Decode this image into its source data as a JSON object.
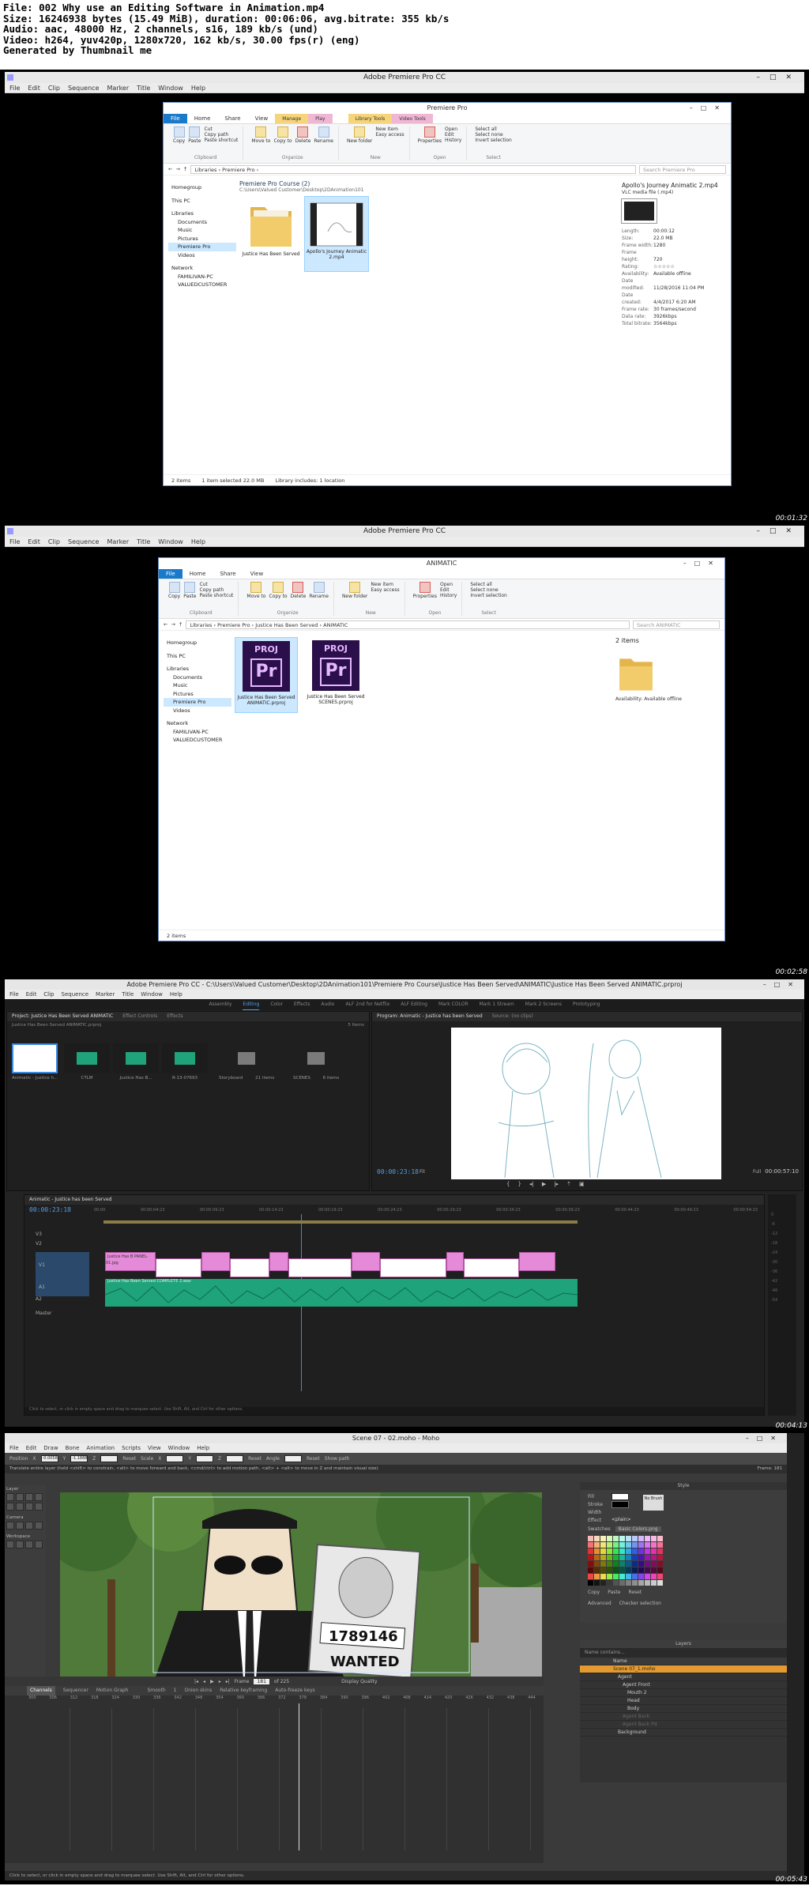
{
  "header": {
    "lines": [
      "File: 002 Why use an Editing Software in Animation.mp4",
      "Size: 16246938 bytes (15.49 MiB), duration: 00:06:06, avg.bitrate: 355 kb/s",
      "Audio: aac, 48000 Hz, 2 channels, s16, 189 kb/s (und)",
      "Video: h264, yuv420p, 1280x720, 162 kb/s, 30.00 fps(r) (eng)",
      "Generated by Thumbnail me"
    ]
  },
  "frame1": {
    "timestamp": "00:01:32",
    "host_title": "Adobe Premiere Pro CC",
    "host_menu": [
      "File",
      "Edit",
      "Clip",
      "Sequence",
      "Marker",
      "Title",
      "Window",
      "Help"
    ],
    "explorer_title": "Premiere Pro",
    "ctx_tabs": [
      "Library Tools",
      "Video Tools"
    ],
    "tabs": [
      "File",
      "Home",
      "Share",
      "View",
      "Manage",
      "Play"
    ],
    "ribbon_groups": [
      {
        "name": "Clipboard",
        "buttons": [
          "Copy",
          "Paste",
          "Cut",
          "Copy path",
          "Paste shortcut"
        ]
      },
      {
        "name": "Organize",
        "buttons": [
          "Move to",
          "Copy to",
          "Delete",
          "Rename"
        ]
      },
      {
        "name": "New",
        "buttons": [
          "New folder",
          "New item",
          "Easy access"
        ]
      },
      {
        "name": "Open",
        "buttons": [
          "Properties",
          "Open",
          "Edit",
          "History"
        ]
      },
      {
        "name": "Select",
        "buttons": [
          "Select all",
          "Select none",
          "Invert selection"
        ]
      }
    ],
    "path": "Libraries  ›  Premiere Pro  ›",
    "search_placeholder": "Search Premiere Pro",
    "nav": [
      "Homegroup",
      "This PC",
      "Libraries",
      "Documents",
      "Music",
      "Pictures",
      "Premiere Pro",
      "Videos",
      "Network",
      "FAMILIVAN-PC",
      "VALUEDCUSTOMER"
    ],
    "group_title": "Premiere Pro Course (2)",
    "group_path": "C:\\Users\\Valued Customer\\Desktop\\2DAnimation101",
    "items": [
      "Justice Has Been Served",
      "Apollo's Journey Animatic 2.mp4"
    ],
    "details_title": "Apollo's Journey Animatic 2.mp4",
    "details_sub": "VLC media file (.mp4)",
    "details": [
      {
        "k": "Length:",
        "v": "00:00:12"
      },
      {
        "k": "Size:",
        "v": "22.0 MB"
      },
      {
        "k": "Frame width:",
        "v": "1280"
      },
      {
        "k": "Frame height:",
        "v": "720"
      },
      {
        "k": "Rating:",
        "v": "☆☆☆☆☆"
      },
      {
        "k": "Availability:",
        "v": "Available offline"
      },
      {
        "k": "Date modified:",
        "v": "11/28/2016 11:04 PM"
      },
      {
        "k": "Date created:",
        "v": "4/4/2017 6:20 AM"
      },
      {
        "k": "Frame rate:",
        "v": "30 frames/second"
      },
      {
        "k": "Data rate:",
        "v": "3926kbps"
      },
      {
        "k": "Total bitrate:",
        "v": "3564kbps"
      }
    ],
    "status": [
      "2 items",
      "1 item selected  22.0 MB",
      "Library includes: 1 location"
    ]
  },
  "frame2": {
    "timestamp": "00:02:58",
    "host_title": "Adobe Premiere Pro CC",
    "explorer_title": "ANIMATIC",
    "tabs": [
      "File",
      "Home",
      "Share",
      "View"
    ],
    "path": "Libraries  ›  Premiere Pro  ›  Justice Has Been Served  ›  ANIMATIC",
    "search_placeholder": "Search ANIMATIC",
    "nav": [
      "Homegroup",
      "This PC",
      "Libraries",
      "Documents",
      "Music",
      "Pictures",
      "Premiere Pro",
      "Videos",
      "Network",
      "FAMILIVAN-PC",
      "VALUEDCUSTOMER"
    ],
    "proj_label": "PROJ",
    "items": [
      "Justice Has Been Served ANIMATIC.prproj",
      "Justice Has Been Served SCENES.prproj"
    ],
    "details_count": "2 items",
    "details_avail_k": "Availability:",
    "details_avail_v": "Available offline",
    "status": [
      "2 items"
    ]
  },
  "frame3": {
    "timestamp": "00:04:13",
    "title": "Adobe Premiere Pro CC - C:\\Users\\Valued Customer\\Desktop\\2DAnimation101\\Premiere Pro Course\\Justice Has Been Served\\ANIMATIC\\Justice Has Been Served ANIMATIC.prproj",
    "menu": [
      "File",
      "Edit",
      "Clip",
      "Sequence",
      "Marker",
      "Title",
      "Window",
      "Help"
    ],
    "workspaces": [
      "Assembly",
      "Editing",
      "Color",
      "Effects",
      "Audio",
      "ALF 2nd for Netflix",
      "ALF Editing",
      "Mark COLOR",
      "Mark 1 Stream",
      "Mark 2 Screens",
      "Prototyping"
    ],
    "active_workspace": "Editing",
    "project_tabs": [
      "Project: Justice Has Been Served ANIMATIC",
      "Effect Controls",
      "Effects"
    ],
    "project_path": "Justice Has Been Served ANIMATIC.prproj",
    "project_count": "5 Items",
    "bins": [
      "Animatic - Justice h...",
      "CTLM",
      "Justice Has B...",
      "R-13-07693",
      "Storyboard",
      "21 items",
      "SCENES",
      "6 items"
    ],
    "program_tabs": [
      "Program: Animatic - Justice has been Served",
      "Source: (no clips)"
    ],
    "program_tc": "00:00:23:18",
    "fit": "Fit",
    "full": "Full",
    "duration": "00:00:57:10",
    "seq_tab": "Animatic - Justice has been Served",
    "seq_tc": "00:00:23:18",
    "ruler": [
      "00:00",
      "00:00:04:23",
      "00:00:09:23",
      "00:00:14:23",
      "00:00:19:23",
      "00:00:24:23",
      "00:00:29:23",
      "00:00:34:23",
      "00:00:39:23",
      "00:00:44:23",
      "00:00:49:23",
      "00:00:54:23"
    ],
    "tracks": [
      "V3",
      "V2",
      "V1",
      "A1",
      "A2",
      "Master"
    ],
    "audio_clip": "Justice Has Been Served COMPLETE 2.wav",
    "video_clip": "Justice Has B PANEL-01.jpg",
    "status": "Click to select, or click in empty space and drag to marquee select. Use Shift, Alt, and Ctrl for other options.",
    "meter": [
      "0",
      "-6",
      "-12",
      "-18",
      "-24",
      "-30",
      "-36",
      "-42",
      "-48",
      "-54"
    ]
  },
  "frame4": {
    "timestamp": "00:05:43",
    "title": "Scene 07 - 02.moho - Moho",
    "menu": [
      "File",
      "Edit",
      "Draw",
      "Bone",
      "Animation",
      "Scripts",
      "View",
      "Window",
      "Help"
    ],
    "opts": [
      "Position",
      "X",
      "-0.0058",
      "Y",
      "-1.1888",
      "Z",
      "Reset",
      "Scale",
      "X",
      "Y",
      "Z",
      "Reset",
      "Angle",
      "Reset",
      "Show path"
    ],
    "hint": "Translate entire layer (hold <shift> to constrain, <alt> to move forward and back, <cmd/ctrl> to add motion path, <alt> + <alt> to move in Z and maintain visual size)",
    "frame_readout": "Frame: 181",
    "tools_labels": [
      "Layer",
      "Camera",
      "Workspace"
    ],
    "style_title": "Style",
    "style_opts": [
      "Fill",
      "Stroke",
      "Width",
      "Effect",
      "No Brush",
      "<plain>"
    ],
    "swatch_tabs": [
      "Swatches",
      "Basic Colors.png"
    ],
    "swatch_buttons": [
      "Copy",
      "Paste",
      "Reset"
    ],
    "style_links": [
      "Advanced",
      "Checker selection"
    ],
    "layers_title": "Layers",
    "layers_search": "Name contains...",
    "layers_head": "Name",
    "layers": [
      "Scene 07_1.moho",
      "Agent",
      "Agent Front",
      "Mouth 2",
      "Head",
      "Body",
      "Agent Back",
      "Agent Back Pd",
      "Background"
    ],
    "poster_number": "1789146",
    "poster_text": "WANTED",
    "tl_tabs": [
      "Channels",
      "Sequencer",
      "Motion Graph"
    ],
    "tl_controls": [
      "Smooth",
      "1",
      "Onion skins",
      "Relative keyframing",
      "Auto-freeze keys"
    ],
    "frame_label": "Frame",
    "frame_value": "181",
    "frame_total": "of 225",
    "display_quality": "Display Quality",
    "ruler": [
      "300",
      "306",
      "312",
      "318",
      "324",
      "330",
      "336",
      "342",
      "348",
      "354",
      "360",
      "366",
      "372",
      "378",
      "384",
      "390",
      "396",
      "402",
      "408",
      "414",
      "420",
      "426",
      "432",
      "438",
      "444"
    ],
    "status": "Click to select, or click in empty space and drag to marquee select. Use Shift, Alt, and Ctrl for other options."
  }
}
